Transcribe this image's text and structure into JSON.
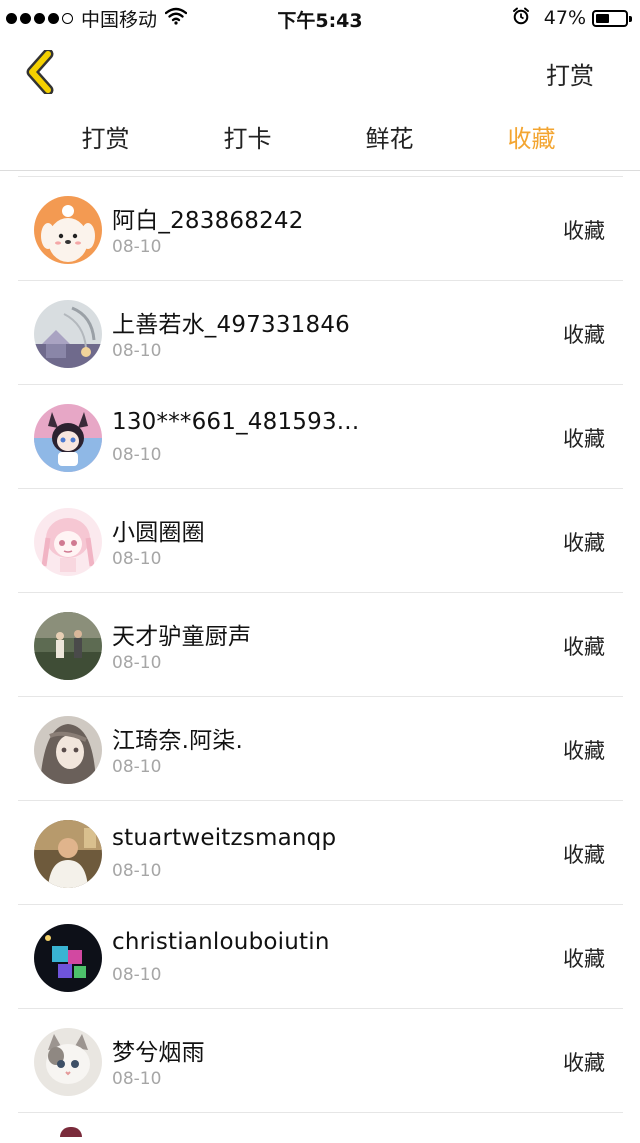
{
  "status_bar": {
    "carrier": "中国移动",
    "time": "下午5:43",
    "battery_percent": "47%",
    "battery_level": 0.47
  },
  "nav": {
    "action_label": "打赏"
  },
  "tabs": [
    {
      "label": "打赏",
      "active": false
    },
    {
      "label": "打卡",
      "active": false
    },
    {
      "label": "鲜花",
      "active": false
    },
    {
      "label": "收藏",
      "active": true
    }
  ],
  "colors": {
    "accent": "#f3a531",
    "back_icon": "#f5d100"
  },
  "list": {
    "items": [
      {
        "name": "阿白_283868242",
        "date": "08-10",
        "action": "收藏",
        "avatar": "cartoon-dog"
      },
      {
        "name": "上善若水_497331846",
        "date": "08-10",
        "action": "收藏",
        "avatar": "sketch-house"
      },
      {
        "name": "130***661_481593...",
        "date": "08-10",
        "action": "收藏",
        "avatar": "anime-cat-girl"
      },
      {
        "name": "小圆圈圈",
        "date": "08-10",
        "action": "收藏",
        "avatar": "pink-anime-girl"
      },
      {
        "name": "天才驴童厨声",
        "date": "08-10",
        "action": "收藏",
        "avatar": "outdoor-photo"
      },
      {
        "name": "江琦奈.阿柒.",
        "date": "08-10",
        "action": "收藏",
        "avatar": "anime-portrait"
      },
      {
        "name": "stuartweitzsmanqp",
        "date": "08-10",
        "action": "收藏",
        "avatar": "person-photo"
      },
      {
        "name": "christianlouboiutin",
        "date": "08-10",
        "action": "收藏",
        "avatar": "neon-cubes"
      },
      {
        "name": "梦兮烟雨",
        "date": "08-10",
        "action": "收藏",
        "avatar": "kitten"
      }
    ]
  }
}
